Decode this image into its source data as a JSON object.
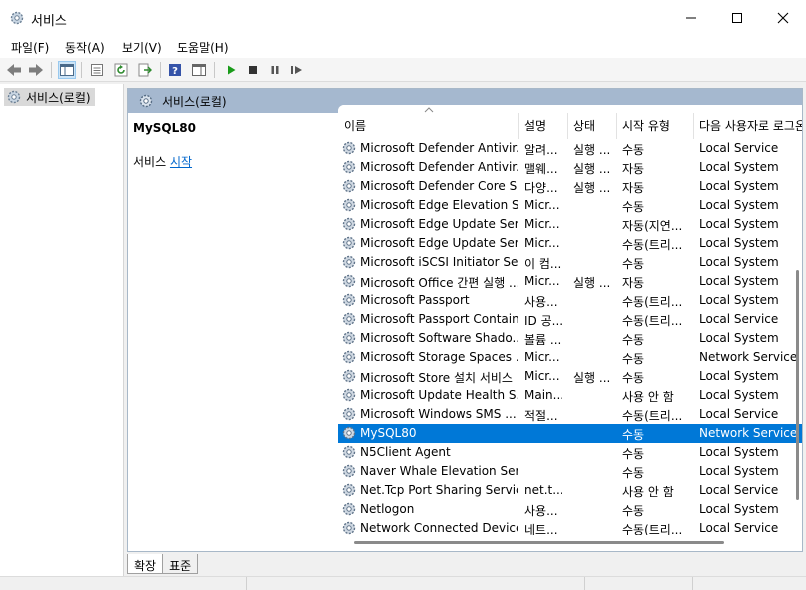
{
  "window": {
    "title": "서비스",
    "minimize_icon": "minimize-icon",
    "maximize_icon": "maximize-icon",
    "close_icon": "close-icon"
  },
  "menu": [
    {
      "label": "파일(F)"
    },
    {
      "label": "동작(A)"
    },
    {
      "label": "보기(V)"
    },
    {
      "label": "도움말(H)"
    }
  ],
  "toolbar": {
    "icons": [
      "back-icon",
      "forward-icon",
      "show-hide-tree-icon",
      "properties-icon",
      "refresh-icon",
      "export-list-icon",
      "help-icon",
      "show-hide-action-pane-icon",
      "start-service-icon",
      "stop-service-icon",
      "pause-service-icon",
      "restart-service-icon"
    ]
  },
  "tree": {
    "root_label": "서비스(로컬)"
  },
  "pane": {
    "header": "서비스(로컬)",
    "selected_service": "MySQL80",
    "action_prefix": "서비스 ",
    "action_link": "시작"
  },
  "columns": {
    "name": "이름",
    "description": "설명",
    "status": "상태",
    "startup_type": "시작 유형",
    "logon_as": "다음 사용자로 로그온"
  },
  "services": [
    {
      "name": "Microsoft Defender Antivir...",
      "description": "알려...",
      "status": "실행 ...",
      "startup": "수동",
      "logon": "Local Service"
    },
    {
      "name": "Microsoft Defender Antivir...",
      "description": "맬웨...",
      "status": "실행 ...",
      "startup": "자동",
      "logon": "Local System"
    },
    {
      "name": "Microsoft Defender Core S...",
      "description": "다양...",
      "status": "실행 ...",
      "startup": "자동",
      "logon": "Local System"
    },
    {
      "name": "Microsoft Edge Elevation S...",
      "description": "Micr...",
      "status": "",
      "startup": "수동",
      "logon": "Local System"
    },
    {
      "name": "Microsoft Edge Update Ser...",
      "description": "Micr...",
      "status": "",
      "startup": "자동(지연...",
      "logon": "Local System"
    },
    {
      "name": "Microsoft Edge Update Ser...",
      "description": "Micr...",
      "status": "",
      "startup": "수동(트리...",
      "logon": "Local System"
    },
    {
      "name": "Microsoft iSCSI Initiator Se...",
      "description": "이 컴...",
      "status": "",
      "startup": "수동",
      "logon": "Local System"
    },
    {
      "name": "Microsoft Office 간편 실행 ...",
      "description": "Micr...",
      "status": "실행 ...",
      "startup": "자동",
      "logon": "Local System"
    },
    {
      "name": "Microsoft Passport",
      "description": "사용...",
      "status": "",
      "startup": "수동(트리...",
      "logon": "Local System"
    },
    {
      "name": "Microsoft Passport Container",
      "description": "ID 공...",
      "status": "",
      "startup": "수동(트리...",
      "logon": "Local Service"
    },
    {
      "name": "Microsoft Software Shado...",
      "description": "볼륨 ...",
      "status": "",
      "startup": "수동",
      "logon": "Local System"
    },
    {
      "name": "Microsoft Storage Spaces ...",
      "description": "Micr...",
      "status": "",
      "startup": "수동",
      "logon": "Network Service"
    },
    {
      "name": "Microsoft Store 설치 서비스",
      "description": "Micr...",
      "status": "실행 ...",
      "startup": "수동",
      "logon": "Local System"
    },
    {
      "name": "Microsoft Update Health S...",
      "description": "Main...",
      "status": "",
      "startup": "사용 안 함",
      "logon": "Local System"
    },
    {
      "name": "Microsoft Windows SMS ...",
      "description": "적절...",
      "status": "",
      "startup": "수동(트리...",
      "logon": "Local Service"
    },
    {
      "name": "MySQL80",
      "description": "",
      "status": "",
      "startup": "수동",
      "logon": "Network Service",
      "selected": true
    },
    {
      "name": "N5Client Agent",
      "description": "",
      "status": "",
      "startup": "수동",
      "logon": "Local System"
    },
    {
      "name": "Naver Whale Elevation Serv...",
      "description": "",
      "status": "",
      "startup": "수동",
      "logon": "Local System"
    },
    {
      "name": "Net.Tcp Port Sharing Service",
      "description": "net.t...",
      "status": "",
      "startup": "사용 안 함",
      "logon": "Local Service"
    },
    {
      "name": "Netlogon",
      "description": "사용...",
      "status": "",
      "startup": "수동",
      "logon": "Local System"
    },
    {
      "name": "Network Connected Device...",
      "description": "네트...",
      "status": "",
      "startup": "수동(트리...",
      "logon": "Local Service"
    }
  ],
  "tabs": [
    {
      "label": "확장"
    },
    {
      "label": "표준"
    }
  ],
  "colors": {
    "selection": "#0078d7",
    "pane_header": "#a5b8cf",
    "link": "#0066cc"
  }
}
